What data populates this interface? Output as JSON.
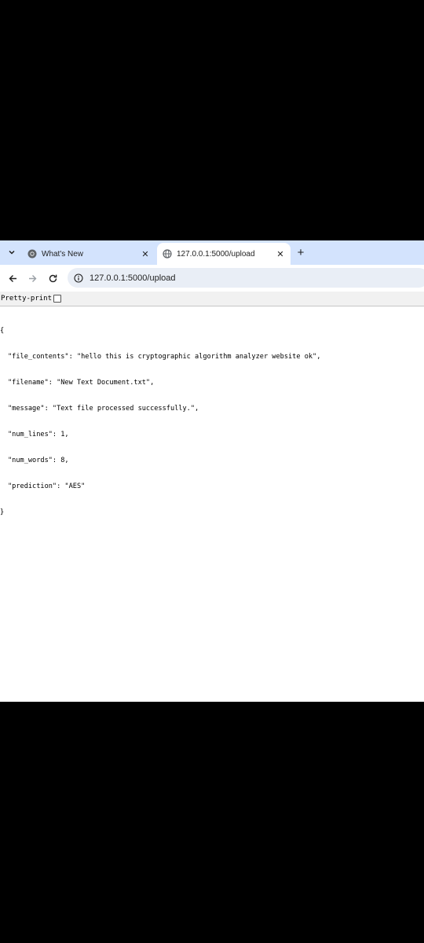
{
  "tabs": [
    {
      "label": "What's New",
      "icon": "chrome-icon",
      "active": false
    },
    {
      "label": "127.0.0.1:5000/upload",
      "icon": "globe-icon",
      "active": true
    }
  ],
  "toolbar": {
    "url": "127.0.0.1:5000/upload"
  },
  "pretty_print": {
    "label": "Pretty-print",
    "checked": false
  },
  "json_lines": {
    "open": "{",
    "l1": "\"file_contents\": \"hello this is cryptographic algorithm analyzer website ok\",",
    "l2": "\"filename\": \"New Text Document.txt\",",
    "l3": "\"message\": \"Text file processed successfully.\",",
    "l4": "\"num_lines\": 1,",
    "l5": "\"num_words\": 8,",
    "l6": "\"prediction\": \"AES\"",
    "close": "}"
  },
  "colors": {
    "tabstrip": "#d3e3fd",
    "omnibox": "#e9eef6"
  }
}
